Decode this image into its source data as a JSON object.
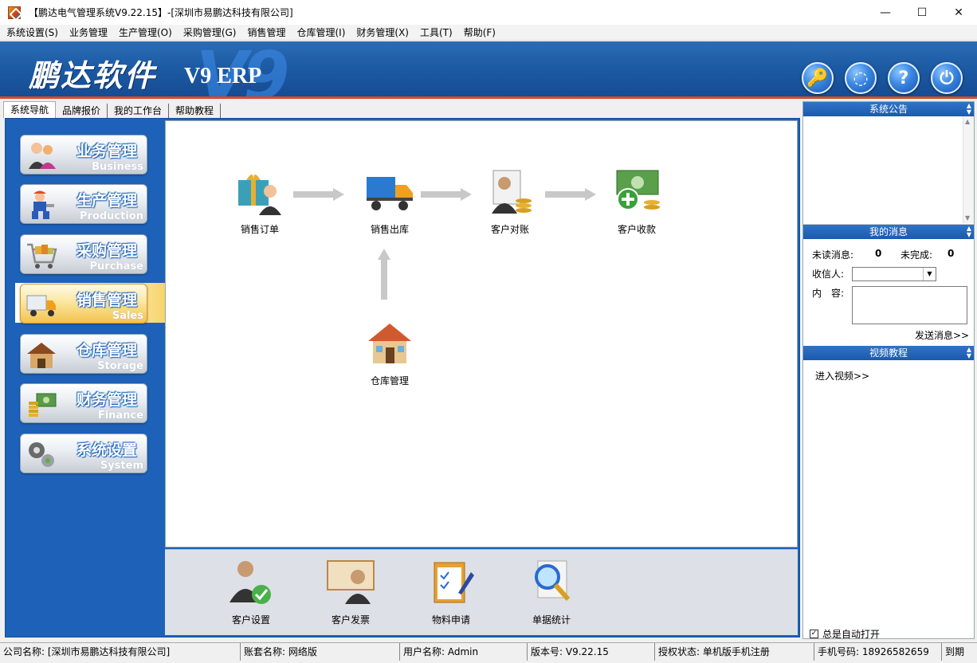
{
  "window": {
    "title": "【鹏达电气管理系统V9.22.15】-[深圳市易鹏达科技有限公司]",
    "controls": {
      "minimize": "—",
      "maximize": "☐",
      "close": "✕"
    }
  },
  "menu": [
    "系统设置(S)",
    "业务管理",
    "生产管理(O)",
    "采购管理(G)",
    "销售管理",
    "仓库管理(I)",
    "财务管理(X)",
    "工具(T)",
    "帮助(F)"
  ],
  "banner": {
    "brand": "鹏达软件",
    "watermark": "V9",
    "product": "V9 ERP",
    "buttons": [
      "🔑",
      "◌",
      "?",
      "⏻"
    ]
  },
  "tabs": [
    "系统导航",
    "品牌报价",
    "我的工作台",
    "帮助教程"
  ],
  "nav": [
    {
      "label": "业务管理",
      "sub": "Business",
      "active": false
    },
    {
      "label": "生产管理",
      "sub": "Production",
      "active": false
    },
    {
      "label": "采购管理",
      "sub": "Purchase",
      "active": false
    },
    {
      "label": "销售管理",
      "sub": "Sales",
      "active": true
    },
    {
      "label": "仓库管理",
      "sub": "Storage",
      "active": false
    },
    {
      "label": "财务管理",
      "sub": "Finance",
      "active": false
    },
    {
      "label": "系统设置",
      "sub": "System",
      "active": false
    }
  ],
  "flow": {
    "sales_order": "销售订单",
    "sales_out": "销售出库",
    "customer_reconcile": "客户对账",
    "customer_receipt": "客户收款",
    "warehouse": "仓库管理"
  },
  "bottom": {
    "customer_setting": "客户设置",
    "customer_invoice": "客户发票",
    "material_request": "物料申请",
    "document_stats": "单据统计"
  },
  "right": {
    "notice_title": "系统公告",
    "msg_title": "我的消息",
    "unread_label": "未读消息:",
    "unread_count": "0",
    "undone_label": "未完成:",
    "undone_count": "0",
    "recipient_label": "收信人:",
    "content_label": "内　容:",
    "send_label": "发送消息>>",
    "video_title": "视频教程",
    "video_link": "进入视频>>",
    "auto_open_label": "总是自动打开",
    "auto_open_checked": "✓"
  },
  "status": {
    "company": "公司名称: [深圳市易鹏达科技有限公司]",
    "account": "账套名称: 网络版",
    "user": "用户名称: Admin",
    "version": "版本号: V9.22.15",
    "license": "授权状态: 单机版手机注册",
    "phone": "手机号码: 18926582659",
    "expiry": "到期"
  }
}
